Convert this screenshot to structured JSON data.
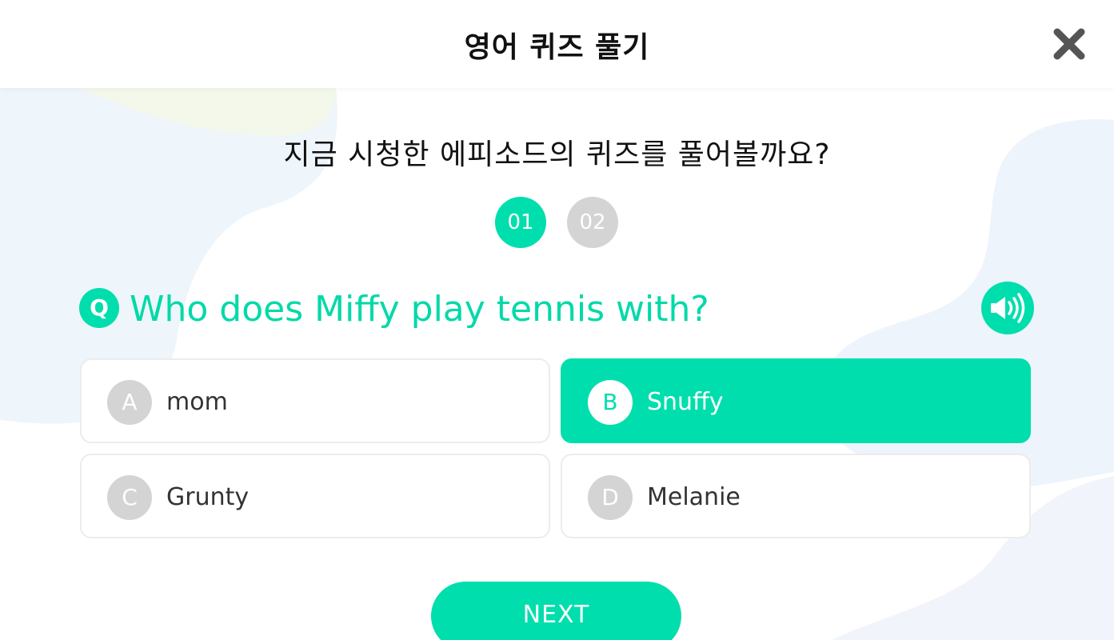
{
  "header": {
    "title": "영어 퀴즈 풀기",
    "close_icon": "close-icon"
  },
  "prompt": "지금 시청한 에피소드의 퀴즈를 풀어볼까요?",
  "steps": [
    {
      "label": "01",
      "active": true
    },
    {
      "label": "02",
      "active": false
    }
  ],
  "question": {
    "badge": "Q",
    "text": "Who does Miffy play tennis with?",
    "audio_icon": "speaker-icon"
  },
  "options": [
    {
      "letter": "A",
      "text": "mom",
      "selected": false
    },
    {
      "letter": "B",
      "text": "Snuffy",
      "selected": true
    },
    {
      "letter": "C",
      "text": "Grunty",
      "selected": false
    },
    {
      "letter": "D",
      "text": "Melanie",
      "selected": false
    }
  ],
  "next_label": "NEXT",
  "colors": {
    "accent": "#00dead",
    "inactive": "#d4d4d4",
    "text": "#111111"
  }
}
